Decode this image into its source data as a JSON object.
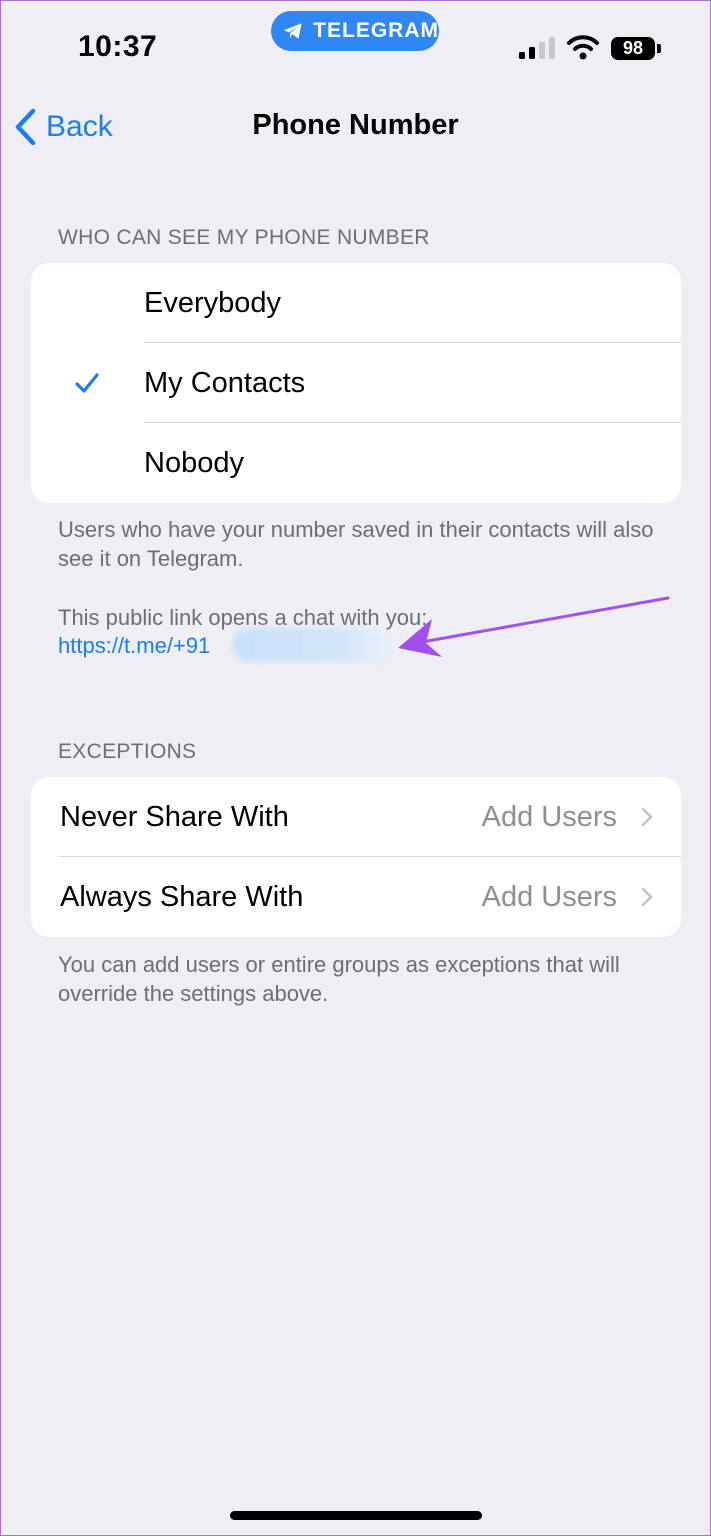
{
  "status_bar": {
    "time": "10:37",
    "app_pill": "TELEGRAM",
    "battery": "98"
  },
  "nav": {
    "back_label": "Back",
    "title": "Phone Number"
  },
  "visibility_section": {
    "header": "WHO CAN SEE MY PHONE NUMBER",
    "options": [
      {
        "label": "Everybody",
        "selected": false
      },
      {
        "label": "My Contacts",
        "selected": true
      },
      {
        "label": "Nobody",
        "selected": false
      }
    ],
    "footer": "Users who have your number saved in their contacts will also see it on Telegram.",
    "link_caption": "This public link opens a chat with you:",
    "link": "https://t.me/+91"
  },
  "exceptions_section": {
    "header": "EXCEPTIONS",
    "rows": [
      {
        "label": "Never Share With",
        "value": "Add Users"
      },
      {
        "label": "Always Share With",
        "value": "Add Users"
      }
    ],
    "footer": "You can add users or entire groups as exceptions that will override the settings above."
  },
  "colors": {
    "accent": "#1a7ef2",
    "background": "#efeef4",
    "annotation_arrow": "#a24ff0"
  }
}
